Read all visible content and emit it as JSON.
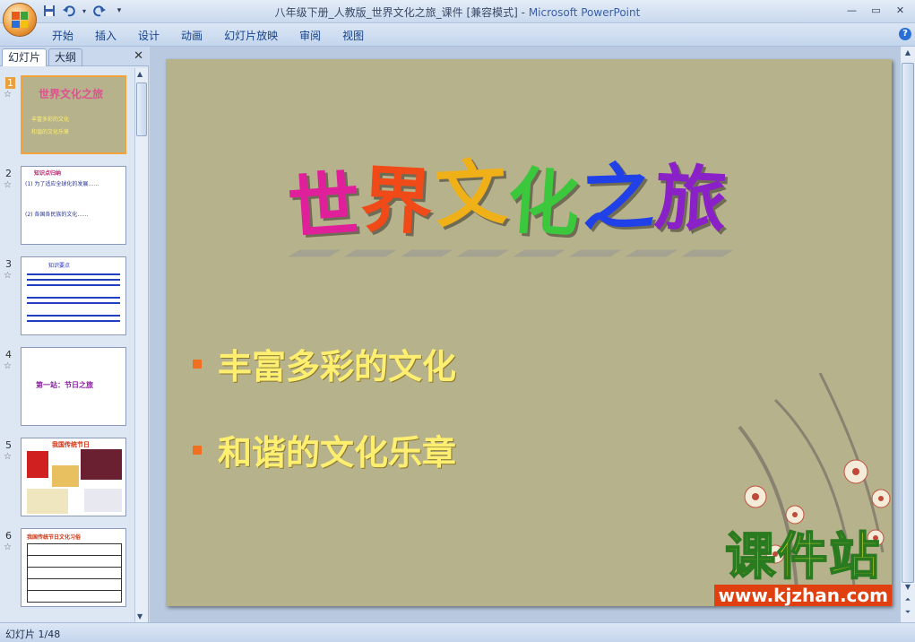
{
  "window": {
    "title": "八年级下册_人教版_世界文化之旅_课件 [兼容模式]",
    "app_name": "Microsoft PowerPoint"
  },
  "ribbon": {
    "tabs": [
      "开始",
      "插入",
      "设计",
      "动画",
      "幻灯片放映",
      "审阅",
      "视图"
    ]
  },
  "left_pane": {
    "tabs": [
      "幻灯片",
      "大纲"
    ],
    "slides": [
      {
        "num": "1",
        "preview_title": "世界文化之旅",
        "preview_lines": [
          "丰富多彩的文化",
          "和谐的文化乐章"
        ]
      },
      {
        "num": "2",
        "preview_title": "知识点归纳",
        "preview_lines": [
          "(1)  为了适应全球化的发展……",
          "(2)  各国各民族的文化……"
        ]
      },
      {
        "num": "3",
        "preview_title": "知识要点",
        "preview_lines": [
          "……",
          "……"
        ]
      },
      {
        "num": "4",
        "preview_title": "第一站：节日之旅",
        "preview_lines": []
      },
      {
        "num": "5",
        "preview_title": "我国传统节日",
        "preview_lines": []
      },
      {
        "num": "6",
        "preview_title": "我国传统节日文化习俗",
        "preview_lines": []
      }
    ]
  },
  "slide": {
    "title_chars": [
      "世",
      "界",
      "文",
      "化",
      "之",
      "旅"
    ],
    "title_colors": [
      "#e0209a",
      "#f04a18",
      "#f0b018",
      "#3cc83c",
      "#2040e8",
      "#8a20c8"
    ],
    "bullets": [
      "丰富多彩的文化",
      "和谐的文化乐章"
    ],
    "watermark_big": "课件站",
    "watermark_url": "www.kjzhan.com"
  },
  "status": {
    "slide_counter": "幻灯片 1/48"
  }
}
